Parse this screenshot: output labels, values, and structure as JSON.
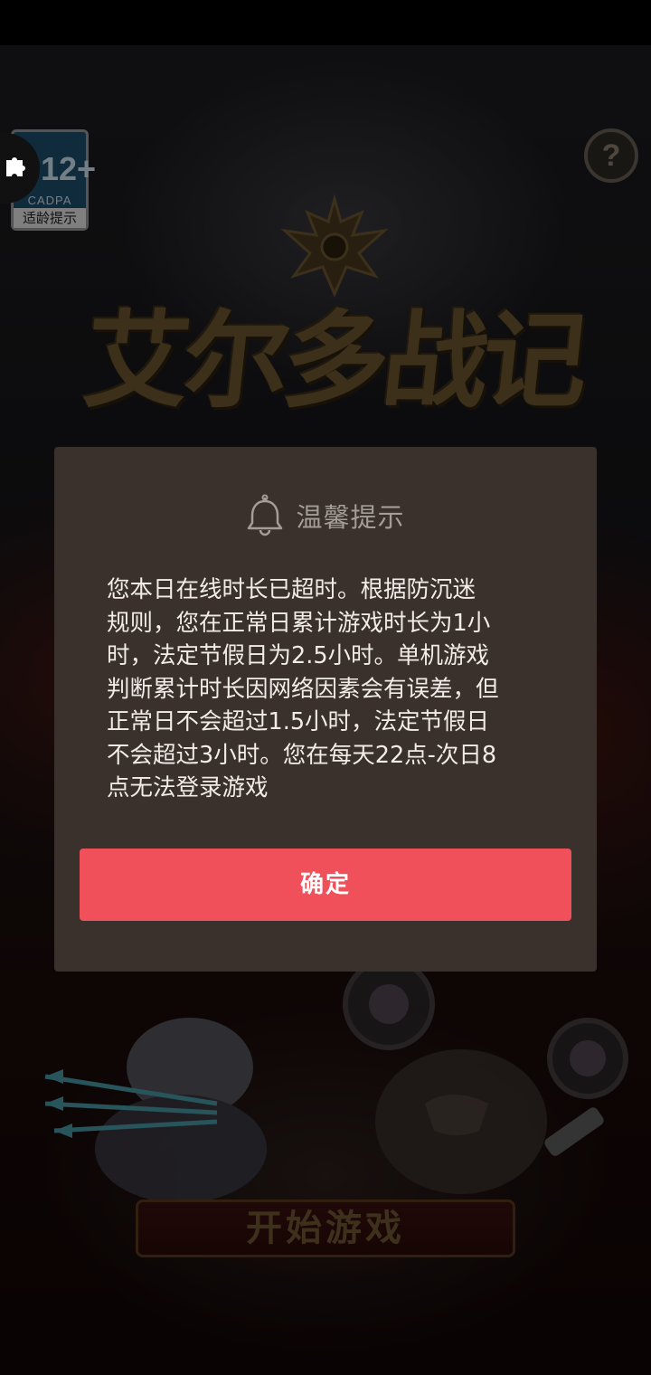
{
  "game": {
    "logo_text": "艾尔多战记",
    "age_rating": {
      "age": "12+",
      "organization": "CADPA",
      "label": "适龄提示"
    },
    "help_label": "?",
    "start_button_label": "开始游戏"
  },
  "dialog": {
    "icon": "bell-icon",
    "title": "温馨提示",
    "message": "您本日在线时长已超时。根据防沉迷\n规则，您在正常日累计游戏时长为1小\n时，法定节假日为2.5小时。单机游戏\n判断累计时长因网络因素会有误差，但\n正常日不会超过1.5小时，法定节假日\n不会超过3小时。您在每天22点-次日8\n点无法登录游戏",
    "confirm_label": "确定"
  },
  "colors": {
    "dialog_background": "#3a302c",
    "confirm_button": "#f0505a",
    "title_text": "#a39c97",
    "body_text": "#f1ece8"
  }
}
